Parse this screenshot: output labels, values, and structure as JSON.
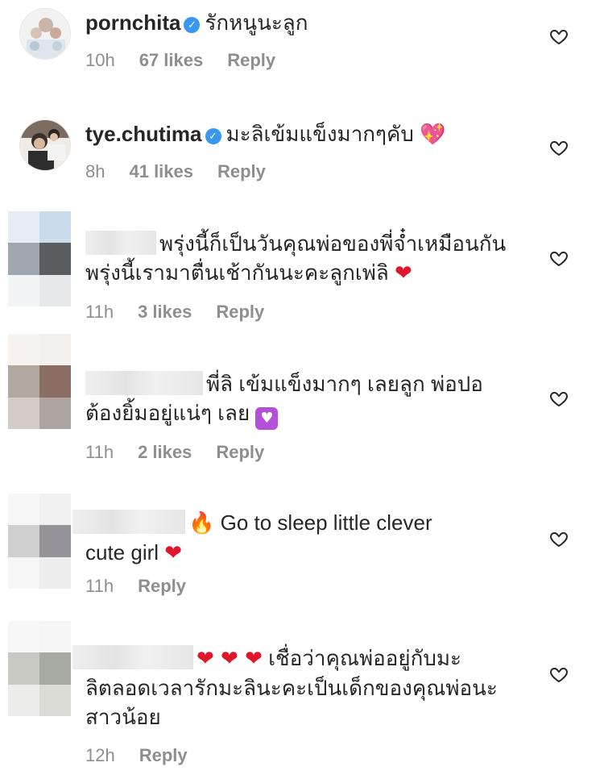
{
  "comments": [
    {
      "username": "pornchita",
      "verified": true,
      "text": "รักหนูนะลูก",
      "time": "10h",
      "likes": "67 likes",
      "reply": "Reply"
    },
    {
      "username": "tye.chutima",
      "verified": true,
      "text": "มะลิเข้มแข็งมากๆคับ",
      "emoji": "💖",
      "time": "8h",
      "likes": "41 likes",
      "reply": "Reply"
    },
    {
      "username_hidden": true,
      "text_line1": "พรุ่งนี้ก็เป็นวันคุณพ่อของพี่จ๋ำเหมือนกัน",
      "text_line2": "พรุ่งนี้เรามาตื่นเช้ากันนะคะลูกเพ่ลิ",
      "emoji": "❤",
      "time": "11h",
      "likes": "3 likes",
      "reply": "Reply"
    },
    {
      "username_hidden": true,
      "text_line1": "พี่ลิ เข้มแข็งมากๆ เลยลูก พ่อปอ",
      "text_line2": "ต้องยิ้มอยู่แน่ๆ เลย",
      "emoji": "♥",
      "time": "11h",
      "likes": "2 likes",
      "reply": "Reply"
    },
    {
      "username_hidden": true,
      "emoji_lead": "🔥",
      "text_line1": "Go to sleep little clever",
      "text_line2": "cute girl",
      "emoji": "❤",
      "time": "11h",
      "reply": "Reply"
    },
    {
      "username_hidden": true,
      "emoji_lead": "❤ ❤ ❤",
      "text_line1": "เชื่อว่าคุณพ่ออยู่กับมะ",
      "text_line2": "ลิตลอดเวลารักมะลินะคะเป็นเด็กของคุณพ่อนะ",
      "text_line3": "สาวน้อย",
      "time": "12h",
      "reply": "Reply"
    }
  ],
  "icons": {
    "verified": "verified-badge-icon",
    "like": "heart-outline-icon"
  },
  "colors": {
    "text": "#262626",
    "meta": "#8e8e8e",
    "verified": "#3897f0",
    "heart": "#e0162b"
  }
}
